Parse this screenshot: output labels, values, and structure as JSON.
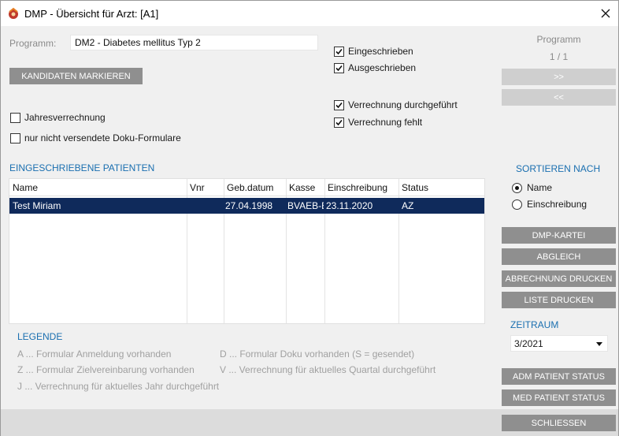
{
  "window": {
    "title": "DMP - Übersicht für Arzt: [A1]"
  },
  "programm": {
    "label": "Programm:",
    "value": "DM2 - Diabetes mellitus Typ 2"
  },
  "buttons": {
    "kandidaten": "KANDIDATEN MARKIEREN",
    "next": ">>",
    "prev": "<<",
    "dmp_kartei": "DMP-KARTEI",
    "abgleich": "ABGLEICH",
    "abrechnung_drucken": "ABRECHNUNG DRUCKEN",
    "liste_drucken": "LISTE DRUCKEN",
    "adm_status": "ADM PATIENT STATUS",
    "med_status": "MED PATIENT STATUS",
    "schliessen": "SCHLIESSEN"
  },
  "pager": {
    "title": "Programm",
    "value": "1 / 1"
  },
  "filters": {
    "jahresverrechnung": {
      "label": "Jahresverrechnung",
      "checked": false
    },
    "nicht_versendet": {
      "label": "nur nicht versendete Doku-Formulare",
      "checked": false
    },
    "eingeschrieben": {
      "label": "Eingeschrieben",
      "checked": true
    },
    "ausgeschrieben": {
      "label": "Ausgeschrieben",
      "checked": true
    },
    "verrechnung_ok": {
      "label": "Verrechnung durchgeführt",
      "checked": true
    },
    "verrechnung_fehlt": {
      "label": "Verrechnung fehlt",
      "checked": true
    }
  },
  "patients": {
    "title": "EINGESCHRIEBENE PATIENTEN",
    "columns": [
      "Name",
      "Vnr",
      "Geb.datum",
      "Kasse",
      "Einschreibung",
      "Status"
    ],
    "rows": [
      [
        "Test Miriam",
        "",
        "27.04.1998",
        "BVAEB-EB",
        "23.11.2020",
        "AZ"
      ]
    ]
  },
  "legend": {
    "title": "LEGENDE",
    "items": [
      "A ... Formular Anmeldung vorhanden",
      "Z ... Formular Zielvereinbarung vorhanden",
      "J ... Verrechnung für aktuelles Jahr durchgeführt",
      "D ... Formular Doku vorhanden (S = gesendet)",
      "V ... Verrechnung für aktuelles Quartal durchgeführt"
    ]
  },
  "sort": {
    "title": "SORTIEREN NACH",
    "options": [
      "Name",
      "Einschreibung"
    ],
    "selected": "Name"
  },
  "zeitraum": {
    "title": "ZEITRAUM",
    "value": "3/2021"
  },
  "colors": {
    "accent": "#1a6fb0",
    "selection": "#0f2a5b",
    "button": "#8f8f8f"
  }
}
